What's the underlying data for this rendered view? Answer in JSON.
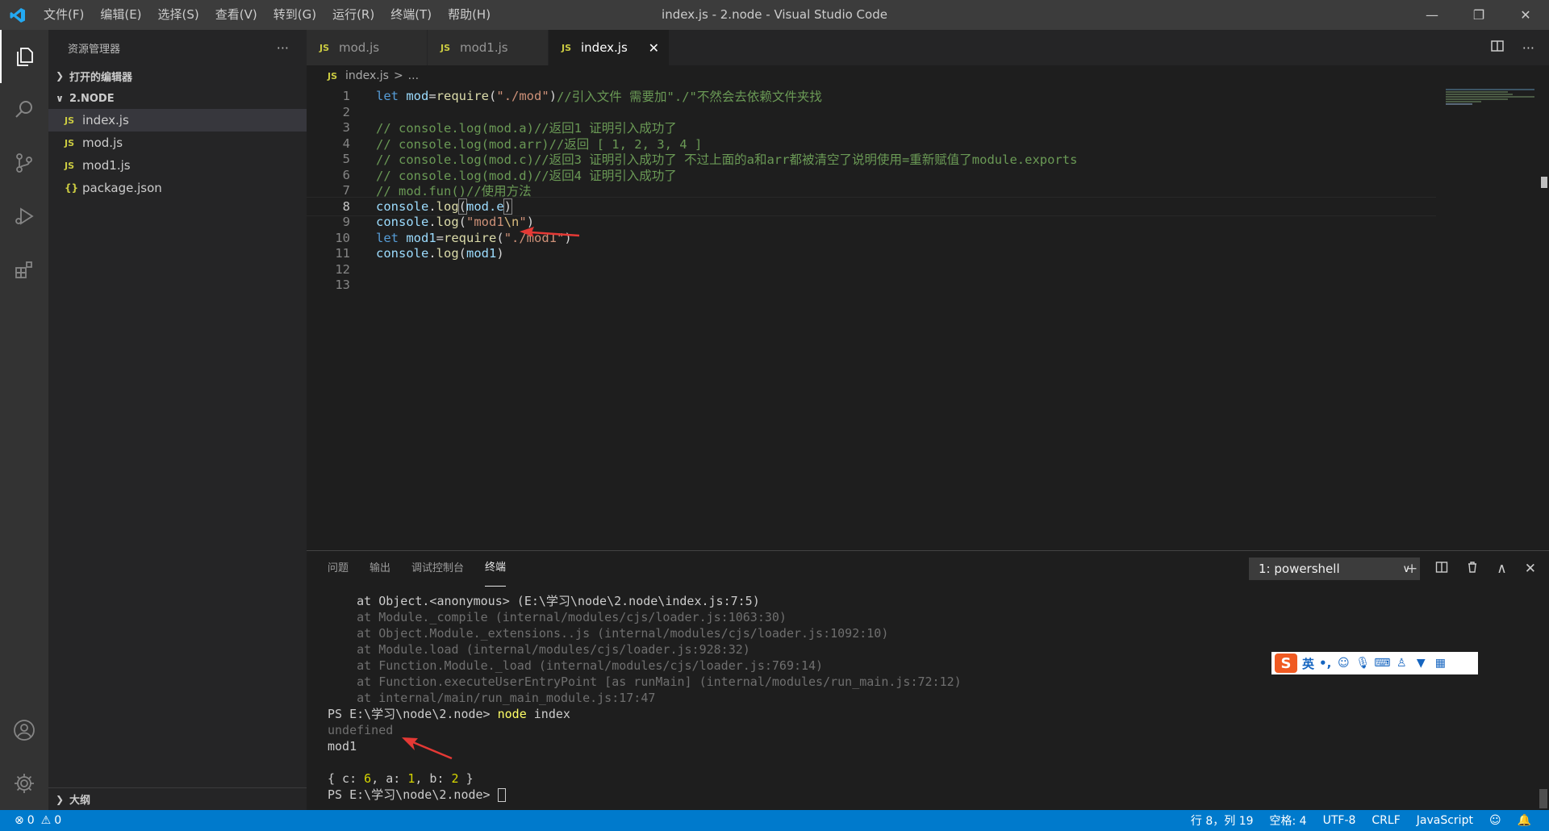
{
  "titlebar": {
    "title": "index.js - 2.node - Visual Studio Code",
    "menu": [
      "文件(F)",
      "编辑(E)",
      "选择(S)",
      "查看(V)",
      "转到(G)",
      "运行(R)",
      "终端(T)",
      "帮助(H)"
    ],
    "minimize": "—",
    "restore": "❐",
    "close": "✕"
  },
  "sidebar": {
    "title": "资源管理器",
    "more": "···",
    "open_editors": "打开的编辑器",
    "folder": "2.NODE",
    "files": [
      {
        "name": "index.js",
        "type": "JS"
      },
      {
        "name": "mod.js",
        "type": "JS"
      },
      {
        "name": "mod1.js",
        "type": "JS"
      },
      {
        "name": "package.json",
        "type": "{}"
      }
    ],
    "outline": "大纲"
  },
  "tabs": [
    {
      "label": "mod.js",
      "badge": "JS"
    },
    {
      "label": "mod1.js",
      "badge": "JS"
    },
    {
      "label": "index.js",
      "badge": "JS"
    }
  ],
  "breadcrumb": {
    "file": "index.js",
    "badge": "JS",
    "sep": ">",
    "more": "..."
  },
  "editor": {
    "current_line": 8,
    "lines": [
      {
        "n": "1"
      },
      {
        "n": "2"
      },
      {
        "n": "3"
      },
      {
        "n": "4"
      },
      {
        "n": "5"
      },
      {
        "n": "6"
      },
      {
        "n": "7"
      },
      {
        "n": "8"
      },
      {
        "n": "9"
      },
      {
        "n": "10"
      },
      {
        "n": "11"
      },
      {
        "n": "12"
      },
      {
        "n": "13"
      }
    ],
    "code": {
      "l1_kw": "let",
      "l1_var": "mod",
      "l1_eq": "=",
      "l1_fn": "require",
      "l1_p1": "(",
      "l1_str": "\"./mod\"",
      "l1_p2": ")",
      "l1_cm": "//引入文件 需要加\"./\"不然会去依赖文件夹找",
      "l3": "// console.log(mod.a)//返回1 证明引入成功了",
      "l4": "// console.log(mod.arr)//返回 [ 1, 2, 3, 4 ]",
      "l5": "// console.log(mod.c)//返回3 证明引入成功了 不过上面的a和arr都被清空了说明使用=重新赋值了module.exports",
      "l6": "// console.log(mod.d)//返回4 证明引入成功了",
      "l7": "// mod.fun()//使用方法",
      "l8_obj": "console",
      "l8_dot": ".",
      "l8_fn": "log",
      "l8_p1": "(",
      "l8_arg": "mod.e",
      "l8_p2": ")",
      "l9_obj": "console",
      "l9_fn": "log",
      "l9_str1": "\"mod1",
      "l9_esc": "\\n",
      "l9_str2": "\"",
      "l10_kw": "let",
      "l10_var": "mod1",
      "l10_fn": "require",
      "l10_str": "\"./mod1\"",
      "l11_obj": "console",
      "l11_fn": "log",
      "l11_arg": "mod1"
    }
  },
  "panel": {
    "tabs": [
      "问题",
      "输出",
      "调试控制台",
      "终端"
    ],
    "active_tab": "终端",
    "terminal_select": "1: powershell",
    "terminal_lines": [
      "    at Object.<anonymous> (E:\\学习\\node\\2.node\\index.js:7:5)",
      "    at Module._compile (internal/modules/cjs/loader.js:1063:30)",
      "    at Object.Module._extensions..js (internal/modules/cjs/loader.js:1092:10)",
      "    at Module.load (internal/modules/cjs/loader.js:928:32)",
      "    at Function.Module._load (internal/modules/cjs/loader.js:769:14)",
      "    at Function.executeUserEntryPoint [as runMain] (internal/modules/run_main.js:72:12)",
      "    at internal/main/run_main_module.js:17:47"
    ],
    "prompt": "PS E:\\学习\\node\\2.node> ",
    "command_cmd": "node",
    "command_arg": " index",
    "undefined": "undefined",
    "mod1": "mod1",
    "obj_open": "{ c: ",
    "obj_c": "6",
    "obj_mid1": ", a: ",
    "obj_a": "1",
    "obj_mid2": ", b: ",
    "obj_b": "2",
    "obj_close": " }",
    "prompt2": "PS E:\\学习\\node\\2.node> "
  },
  "ime": {
    "logo": "S",
    "lang": "英",
    "punct": "•,"
  },
  "statusbar": {
    "errors": "0",
    "warnings": "0",
    "position": "行 8，列 19",
    "spaces": "空格: 4",
    "encoding": "UTF-8",
    "eol": "CRLF",
    "language": "JavaScript"
  },
  "colors": {
    "accent": "#007acc",
    "keyword": "#569cd6",
    "comment": "#6a9955",
    "string": "#ce9178",
    "function": "#dcdcaa",
    "annotation_arrow": "#e53935"
  }
}
